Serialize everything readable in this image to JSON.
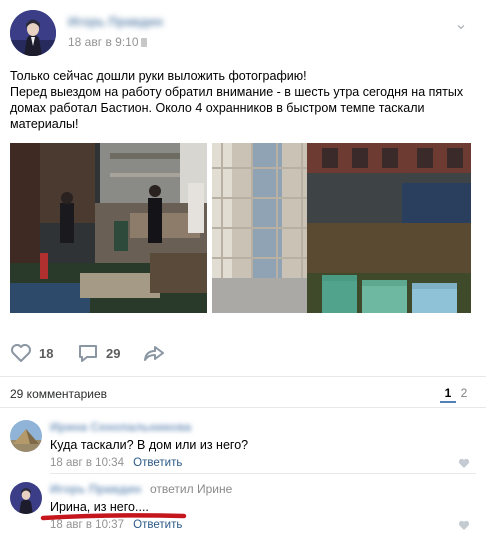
{
  "post": {
    "author": "Игорь Правдин",
    "date": "18 авг в 9:10",
    "text_lines": [
      "Только сейчас дошли руки выложить фотографию!",
      "Перед выездом на работу обратил внимание - в шесть утра сегодня на пятых",
      "домах работал Бастион. Около 4 охранников в быстром темпе таскали",
      "материалы!"
    ],
    "photos": [
      {
        "icon": "construction-photo-workers"
      },
      {
        "icon": "construction-photo-scaffolding"
      }
    ],
    "actions": {
      "likes": "18",
      "comments": "29",
      "like_icon": "heart-icon",
      "comment_icon": "comment-icon",
      "share_icon": "share-icon"
    }
  },
  "comments_section": {
    "count_label": "29 комментариев",
    "pages": [
      "1",
      "2"
    ],
    "active_page": "1"
  },
  "comments": [
    {
      "author": "Ирина Сенопальникова",
      "text": "Куда таскали? В дом или из него?",
      "date": "18 авг в 10:34",
      "reply_label": "Ответить"
    },
    {
      "author": "Игорь Правдин",
      "reply_to": "ответил Ирине",
      "text": "Ирина, из него....",
      "date": "18 авг в 10:37",
      "reply_label": "Ответить"
    }
  ],
  "colors": {
    "link": "#2a5885",
    "accent": "#5181b8",
    "annotation": "#c4161c"
  }
}
